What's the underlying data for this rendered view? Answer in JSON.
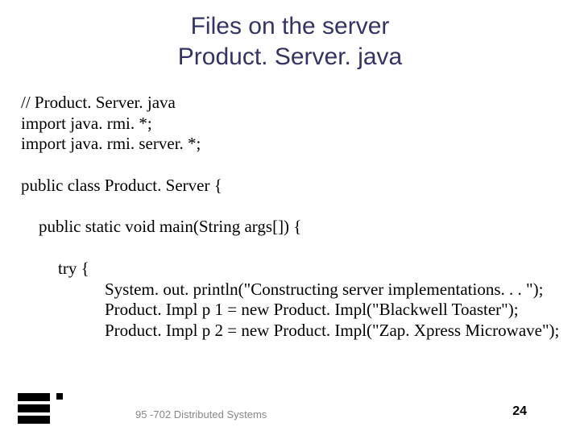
{
  "title_line1": "Files on the server",
  "title_line2": "Product. Server. java",
  "code": {
    "l1": "// Product. Server. java",
    "l2": "import java. rmi. *;",
    "l3": "import java. rmi. server. *;",
    "l4": "public class Product. Server {",
    "l5": "public static void main(String args[]) {",
    "l6": "try {",
    "l7": "System. out. println(\"Constructing server implementations. . . \");",
    "l8": "Product. Impl p 1 = new Product. Impl(\"Blackwell Toaster\");",
    "l9": "Product. Impl p 2 = new Product. Impl(\"Zap. Xpress Microwave\");"
  },
  "footer": {
    "course": "95 -702 Distributed Systems",
    "page": "24"
  }
}
